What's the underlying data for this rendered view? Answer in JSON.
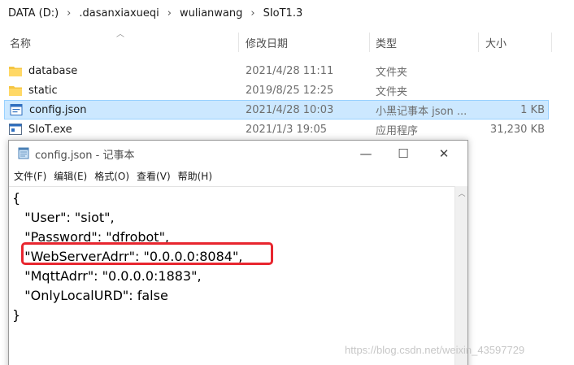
{
  "breadcrumb": [
    "DATA (D:)",
    ".dasanxiaxueqi",
    "wulianwang",
    "SIoT1.3"
  ],
  "columns": {
    "name": "名称",
    "date": "修改日期",
    "type": "类型",
    "size": "大小"
  },
  "files": [
    {
      "name": "database",
      "date": "2021/4/28 11:11",
      "type": "文件夹",
      "size": "",
      "icon": "folder-icon",
      "selected": false
    },
    {
      "name": "static",
      "date": "2019/8/25 12:25",
      "type": "文件夹",
      "size": "",
      "icon": "folder-icon",
      "selected": false
    },
    {
      "name": "config.json",
      "date": "2021/4/28 10:03",
      "type": "小黑记事本 json ...",
      "size": "1 KB",
      "icon": "json-file-icon",
      "selected": true
    },
    {
      "name": "SIoT.exe",
      "date": "2021/1/3 19:05",
      "type": "应用程序",
      "size": "31,230 KB",
      "icon": "exe-file-icon",
      "selected": false
    }
  ],
  "notepad": {
    "title": "config.json - 记事本",
    "menu": [
      "文件(F)",
      "编辑(E)",
      "格式(O)",
      "查看(V)",
      "帮助(H)"
    ],
    "lines": [
      "{",
      "   \"User\": \"siot\",",
      "   \"Password\": \"dfrobot\",",
      "   \"WebServerAdrr\": \"0.0.0.0:8084\",",
      "   \"MqttAdrr\": \"0.0.0.0:1883\",",
      "   \"OnlyLocalURD\": false",
      "}"
    ],
    "highlight_color": "#e8262f"
  },
  "colors": {
    "selection": "#cce8ff",
    "selection_border": "#99d1ff",
    "folder": "#f5c542"
  },
  "watermark": "https://blog.csdn.net/weixin_43597729"
}
